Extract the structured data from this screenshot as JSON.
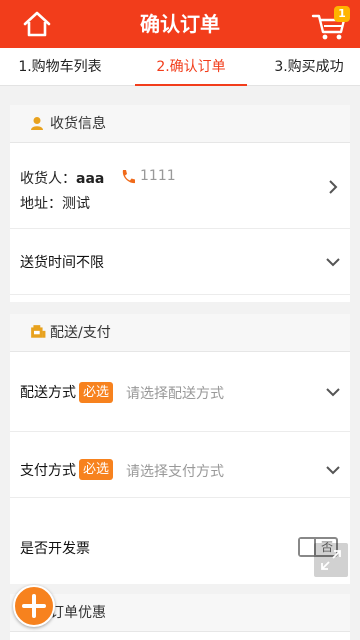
{
  "header": {
    "title": "确认订单",
    "cart_count": "1",
    "icons": {
      "home": "home-icon",
      "cart": "cart-icon"
    },
    "colors": {
      "brand": "#f23d1b",
      "badge": "#ffb400"
    }
  },
  "steps": [
    {
      "label": "1.购物车列表",
      "active": false
    },
    {
      "label": "2.确认订单",
      "active": true
    },
    {
      "label": "3.购买成功",
      "active": false
    }
  ],
  "shipping_section": {
    "title": "收货信息",
    "icon": "person-icon",
    "receiver_label": "收货人：",
    "receiver_name": "aaa",
    "phone": "1111",
    "phone_icon": "phone-icon",
    "address_label": "地址：",
    "address": "测试",
    "delivery_time": "送货时间不限"
  },
  "delivery_section": {
    "title": "配送/支付",
    "icon": "delivery-icon",
    "required_badge": "必选",
    "delivery_method_label": "配送方式",
    "delivery_method_placeholder": "请选择配送方式",
    "payment_method_label": "支付方式",
    "payment_method_placeholder": "请选择支付方式",
    "invoice_label": "是否开发票",
    "invoice_toggle_text": "否",
    "accent_color": "#f7821e"
  },
  "discount_section": {
    "title": "订单优惠"
  },
  "floating": {
    "add_icon": "plus-icon",
    "fullscreen_icon": "expand-icon"
  }
}
